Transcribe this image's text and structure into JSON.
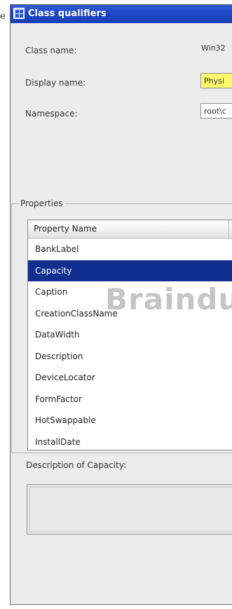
{
  "edge_text": "e",
  "window": {
    "title": "Class qualifiers",
    "title_icon": "window-icon"
  },
  "form": {
    "class_name_label": "Class name:",
    "class_name_value": "Win32",
    "display_name_label": "Display name:",
    "display_name_value": "Physi",
    "namespace_label": "Namespace:",
    "namespace_value": "root\\c"
  },
  "properties": {
    "group_label": "Properties",
    "column_header": "Property Name",
    "rows": [
      "BankLabel",
      "Capacity",
      "Caption",
      "CreationClassName",
      "DataWidth",
      "Description",
      "DeviceLocator",
      "FormFactor",
      "HotSwappable",
      "InstallDate"
    ],
    "selected_index": 1
  },
  "watermark": "Braindu",
  "description": {
    "label": "Description of Capacity:",
    "text": ""
  },
  "colors": {
    "titlebar": "#1d45c4",
    "selected_row": "#102f8f",
    "highlight_field": "#fffa6b"
  }
}
